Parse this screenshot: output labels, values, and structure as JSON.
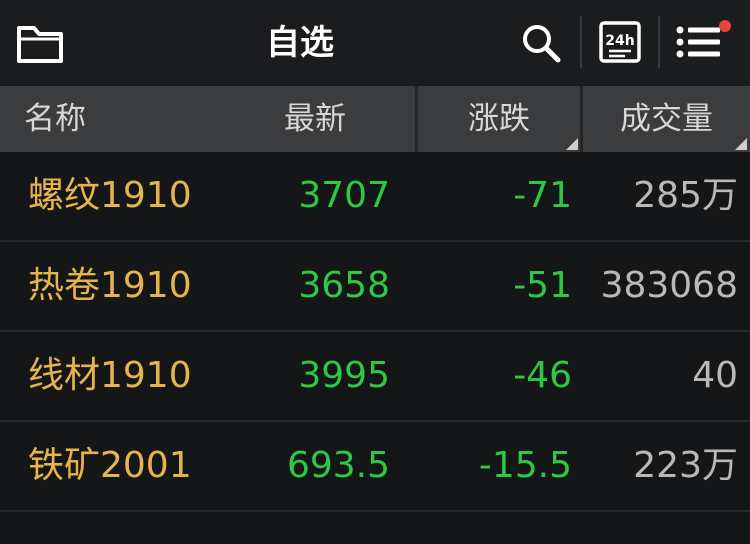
{
  "header": {
    "title": "自选",
    "icons": [
      "folder-icon",
      "search-icon",
      "clock-24h-icon",
      "menu-list-icon"
    ],
    "notification_dot_color": "#e8433c"
  },
  "columns": [
    {
      "label": "名称",
      "sortable": false
    },
    {
      "label": "最新",
      "sortable": false
    },
    {
      "label": "涨跌",
      "sortable": true
    },
    {
      "label": "成交量",
      "sortable": true
    }
  ],
  "rows": [
    {
      "name": "螺纹1910",
      "latest": "3707",
      "change": "-71",
      "volume": "285万"
    },
    {
      "name": "热卷1910",
      "latest": "3658",
      "change": "-51",
      "volume": "383068"
    },
    {
      "name": "线材1910",
      "latest": "3995",
      "change": "-46",
      "volume": "40"
    },
    {
      "name": "铁矿2001",
      "latest": "693.5",
      "change": "-15.5",
      "volume": "223万"
    }
  ],
  "colors": {
    "name": "#e6b44c",
    "price_down": "#2ec845",
    "volume": "#b9b9b9",
    "header_bg": "#3b3c3e",
    "background": "#151617"
  }
}
